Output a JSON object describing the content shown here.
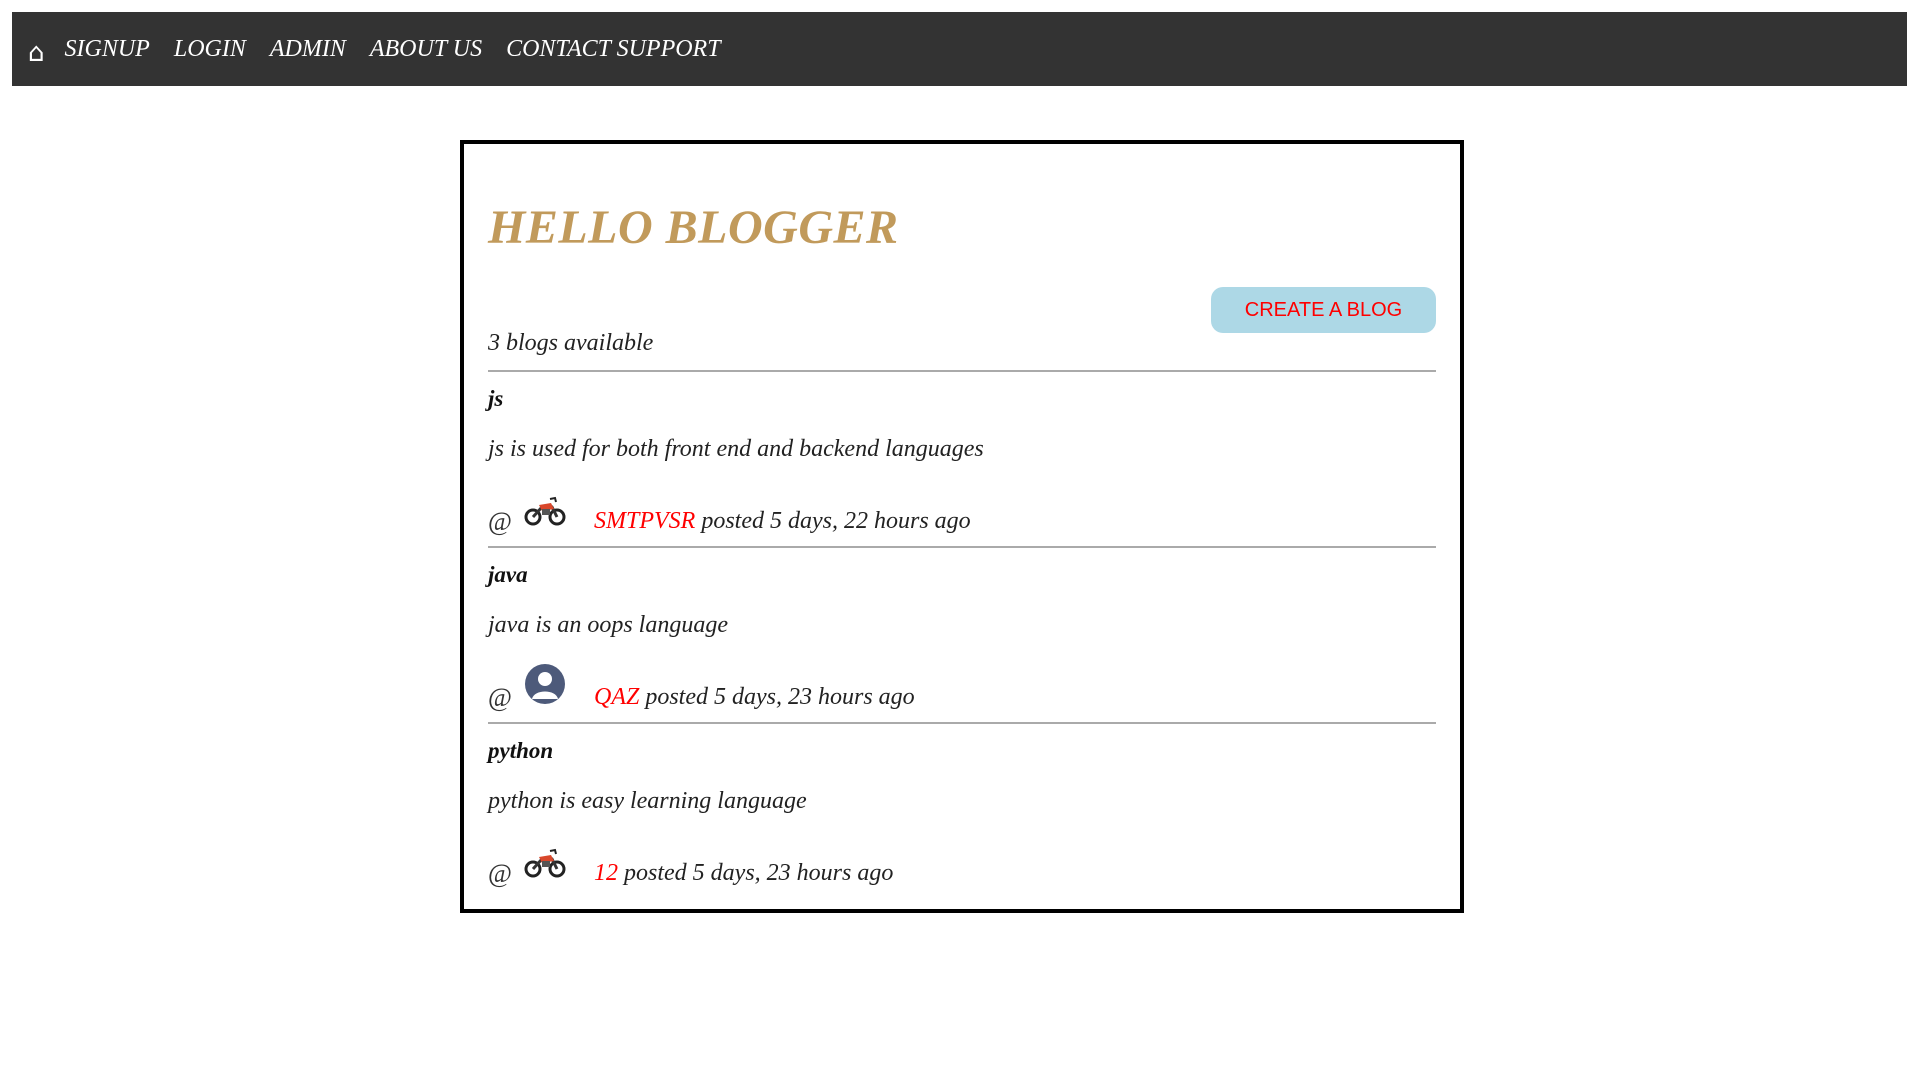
{
  "nav": {
    "home_icon": "home-icon",
    "links": [
      "SIGNUP",
      "LOGIN",
      "ADMIN",
      "ABOUT US",
      "CONTACT SUPPORT"
    ]
  },
  "main": {
    "title": "HELLO BLOGGER",
    "create_button": "CREATE A BLOG",
    "blog_count": "3 blogs available",
    "posts": [
      {
        "title": "js",
        "body": "js is used for both front end and backend languages",
        "at": "@",
        "avatar": "motorcycle-avatar-icon",
        "author": "SMTPVSR",
        "posted": " posted 5 days, 22 hours ago"
      },
      {
        "title": "java",
        "body": "java is an oops language",
        "at": "@",
        "avatar": "default-user-avatar-icon",
        "author": "QAZ",
        "posted": " posted 5 days, 23 hours ago"
      },
      {
        "title": "python",
        "body": "python is easy learning language",
        "at": "@",
        "avatar": "motorcycle-avatar-icon",
        "author": "12",
        "posted": " posted 5 days, 23 hours ago"
      }
    ]
  },
  "colors": {
    "navbar_bg": "#333333",
    "title": "#c19a5b",
    "button_bg": "#add8e6",
    "link_red": "#ff0000"
  }
}
